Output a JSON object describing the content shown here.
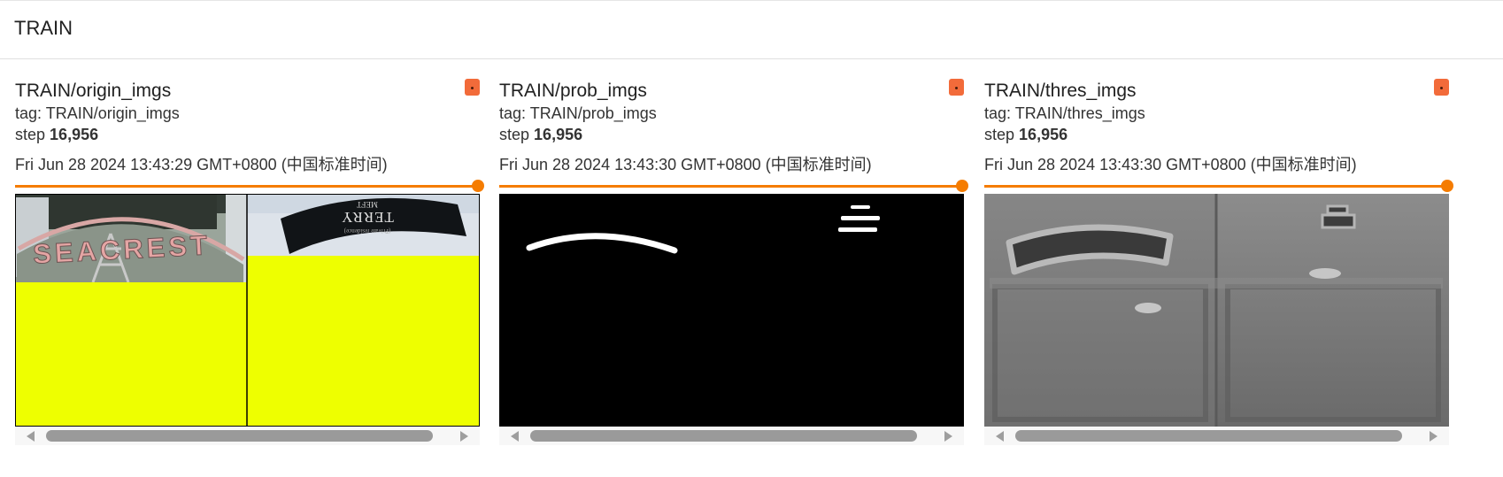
{
  "section": {
    "title": "TRAIN"
  },
  "cards": [
    {
      "title": "TRAIN/origin_imgs",
      "tag": "tag: TRAIN/origin_imgs",
      "step_label": "step",
      "step_value": "16,956",
      "timestamp": "Fri Jun 28 2024 13:43:29 GMT+0800 (中国标准时间)"
    },
    {
      "title": "TRAIN/prob_imgs",
      "tag": "tag: TRAIN/prob_imgs",
      "step_label": "step",
      "step_value": "16,956",
      "timestamp": "Fri Jun 28 2024 13:43:30 GMT+0800 (中国标准时间)"
    },
    {
      "title": "TRAIN/thres_imgs",
      "tag": "tag: TRAIN/thres_imgs",
      "step_label": "step",
      "step_value": "16,956",
      "timestamp": "Fri Jun 28 2024 13:43:30 GMT+0800 (中国标准时间)"
    }
  ],
  "images": {
    "origin": {
      "left_text": "SEACREST",
      "right_text_top": "MEFT",
      "right_text_main": "TERRY",
      "right_text_sub": "(Private residence)"
    }
  },
  "colors": {
    "accent": "#f57c00",
    "pin": "#f26b3a",
    "yellow_fill": "#eeff00"
  },
  "icons": {
    "pin": "pin-icon",
    "scroll_left": "scroll-left-arrow-icon",
    "scroll_right": "scroll-right-arrow-icon"
  }
}
